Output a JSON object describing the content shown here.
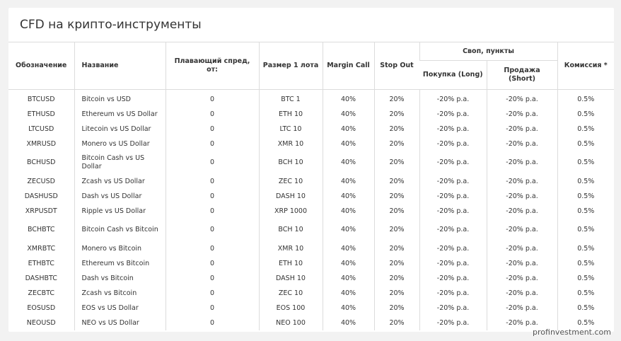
{
  "title": "CFD на крипто-инструменты",
  "headers": {
    "symbol": "Обозначение",
    "name": "Название",
    "spread": "Плавающий спред, от:",
    "lot": "Размер 1 лота",
    "margin_call": "Margin Call",
    "stop_out": "Stop Out",
    "swap": "Своп, пункты",
    "swap_long": "Покупка (Long)",
    "swap_short": "Продажа (Short)",
    "commission": "Комиссия *"
  },
  "rows": [
    {
      "symbol": "BTCUSD",
      "name": "Bitcoin vs USD",
      "spread": "0",
      "lot": "BTC 1",
      "margin_call": "40%",
      "stop_out": "20%",
      "long": "-20% p.a.",
      "short": "-20% p.a.",
      "commission": "0.5%"
    },
    {
      "symbol": "ETHUSD",
      "name": "Ethereum vs US Dollar",
      "spread": "0",
      "lot": "ETH 10",
      "margin_call": "40%",
      "stop_out": "20%",
      "long": "-20% p.a.",
      "short": "-20% p.a.",
      "commission": "0.5%"
    },
    {
      "symbol": "LTCUSD",
      "name": "Litecoin vs US Dollar",
      "spread": "0",
      "lot": "LTC 10",
      "margin_call": "40%",
      "stop_out": "20%",
      "long": "-20% p.a.",
      "short": "-20% p.a.",
      "commission": "0.5%"
    },
    {
      "symbol": "XMRUSD",
      "name": "Monero vs US Dollar",
      "spread": "0",
      "lot": "XMR 10",
      "margin_call": "40%",
      "stop_out": "20%",
      "long": "-20% p.a.",
      "short": "-20% p.a.",
      "commission": "0.5%"
    },
    {
      "symbol": "BCHUSD",
      "name": "Bitcoin Cash vs US Dollar",
      "spread": "0",
      "lot": "BCH 10",
      "margin_call": "40%",
      "stop_out": "20%",
      "long": "-20% p.a.",
      "short": "-20% p.a.",
      "commission": "0.5%"
    },
    {
      "symbol": "ZECUSD",
      "name": "Zcash vs US Dollar",
      "spread": "0",
      "lot": "ZEC 10",
      "margin_call": "40%",
      "stop_out": "20%",
      "long": "-20% p.a.",
      "short": "-20% p.a.",
      "commission": "0.5%"
    },
    {
      "symbol": "DASHUSD",
      "name": "Dash vs US Dollar",
      "spread": "0",
      "lot": "DASH 10",
      "margin_call": "40%",
      "stop_out": "20%",
      "long": "-20% p.a.",
      "short": "-20% p.a.",
      "commission": "0.5%"
    },
    {
      "symbol": "XRPUSDT",
      "name": "Ripple vs US Dollar",
      "spread": "0",
      "lot": "XRP 1000",
      "margin_call": "40%",
      "stop_out": "20%",
      "long": "-20% p.a.",
      "short": "-20% p.a.",
      "commission": "0.5%"
    },
    {
      "symbol": "BCHBTC",
      "name": "Bitcoin Cash vs Bitcoin",
      "spread": "0",
      "lot": "BCH 10",
      "margin_call": "40%",
      "stop_out": "20%",
      "long": "-20% p.a.",
      "short": "-20% p.a.",
      "commission": "0.5%"
    },
    {
      "symbol": "XMRBTC",
      "name": "Monero vs Bitcoin",
      "spread": "0",
      "lot": "XMR 10",
      "margin_call": "40%",
      "stop_out": "20%",
      "long": "-20% p.a.",
      "short": "-20% p.a.",
      "commission": "0.5%"
    },
    {
      "symbol": "ETHBTC",
      "name": "Ethereum vs Bitcoin",
      "spread": "0",
      "lot": "ETH 10",
      "margin_call": "40%",
      "stop_out": "20%",
      "long": "-20% p.a.",
      "short": "-20% p.a.",
      "commission": "0.5%"
    },
    {
      "symbol": "DASHBTC",
      "name": "Dash vs Bitcoin",
      "spread": "0",
      "lot": "DASH 10",
      "margin_call": "40%",
      "stop_out": "20%",
      "long": "-20% p.a.",
      "short": "-20% p.a.",
      "commission": "0.5%"
    },
    {
      "symbol": "ZECBTC",
      "name": "Zcash vs Bitcoin",
      "spread": "0",
      "lot": "ZEC 10",
      "margin_call": "40%",
      "stop_out": "20%",
      "long": "-20% p.a.",
      "short": "-20% p.a.",
      "commission": "0.5%"
    },
    {
      "symbol": "EOSUSD",
      "name": "EOS vs US Dollar",
      "spread": "0",
      "lot": "EOS 100",
      "margin_call": "40%",
      "stop_out": "20%",
      "long": "-20% p.a.",
      "short": "-20% p.a.",
      "commission": "0.5%"
    },
    {
      "symbol": "NEOUSD",
      "name": "NEO vs US Dollar",
      "spread": "0",
      "lot": "NEO 100",
      "margin_call": "40%",
      "stop_out": "20%",
      "long": "-20% p.a.",
      "short": "-20% p.a.",
      "commission": "0.5%"
    }
  ],
  "watermark": "profinvestment.com"
}
